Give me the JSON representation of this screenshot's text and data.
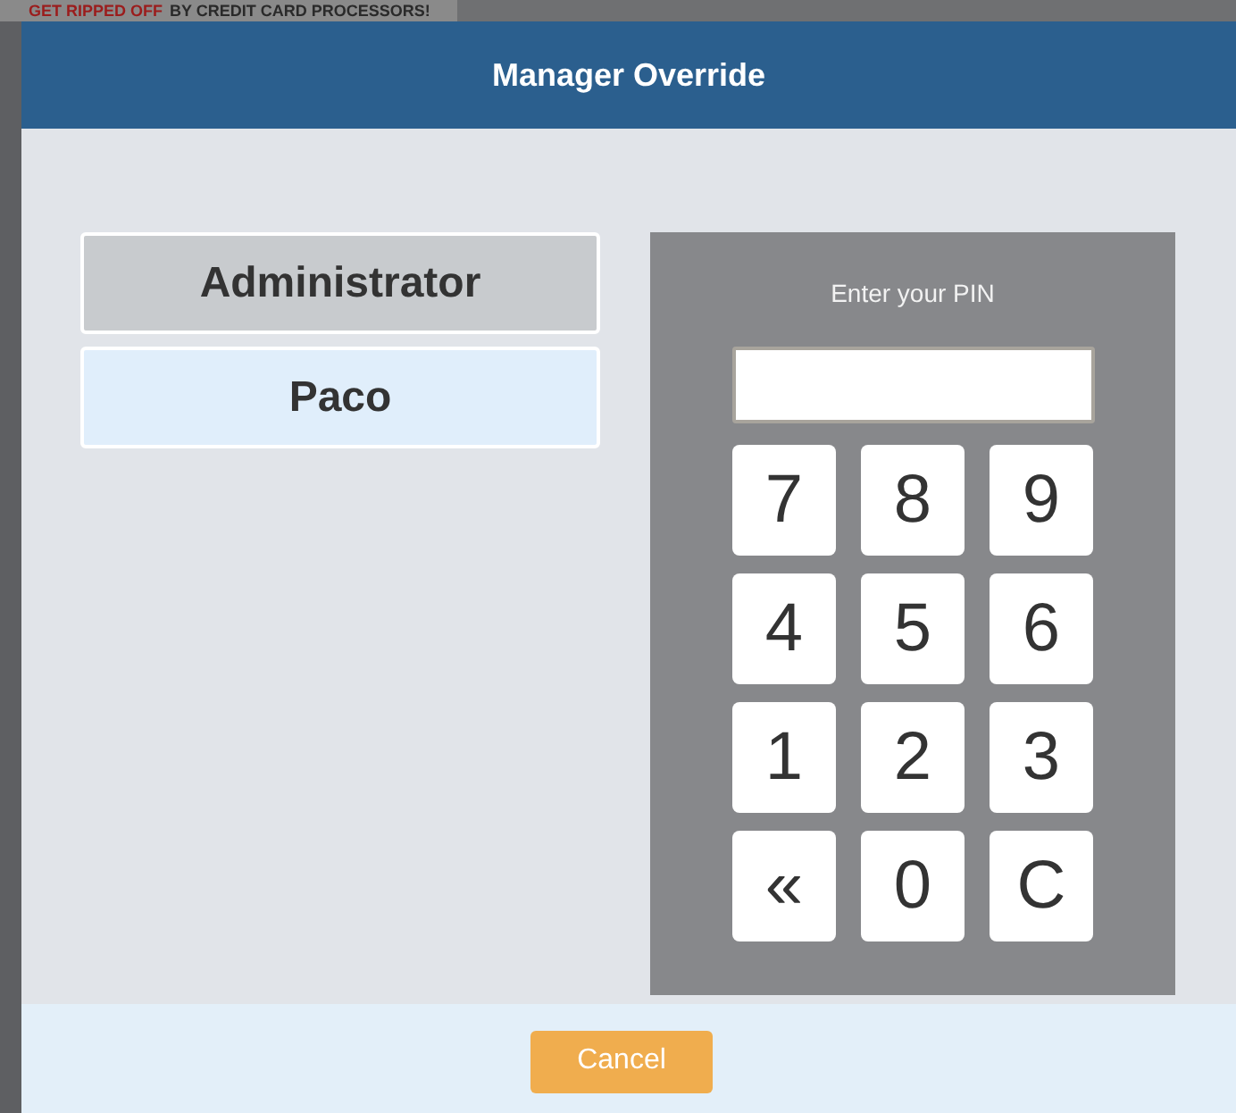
{
  "background_banner": [
    {
      "text": "GET RIPPED OFF",
      "kind": "alert"
    },
    {
      "text": "BY CREDIT CARD PROCESSORS!",
      "kind": "plain"
    }
  ],
  "dialog": {
    "title": "Manager Override",
    "users": [
      {
        "label": "Administrator",
        "selected": true
      },
      {
        "label": "Paco",
        "selected": false
      }
    ],
    "keypad": {
      "prompt": "Enter your PIN",
      "keys": [
        "7",
        "8",
        "9",
        "4",
        "5",
        "6",
        "1",
        "2",
        "3",
        "«",
        "0",
        "C"
      ]
    },
    "buttons": [
      "Cancel"
    ]
  }
}
